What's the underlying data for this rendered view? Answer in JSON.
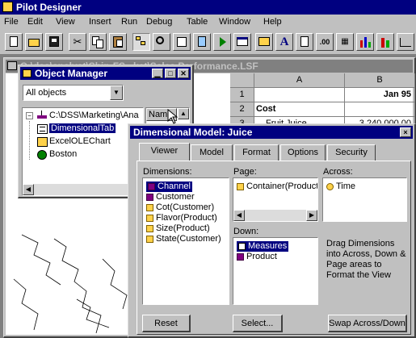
{
  "app": {
    "title": "Pilot Designer",
    "menu": [
      "File",
      "Edit",
      "View",
      "Insert",
      "Run",
      "Debug",
      "Table",
      "Window",
      "Help"
    ]
  },
  "document": {
    "title": "C:\\dss\\analyst\\Ship-FS...ket\\Sales Performance.LSF",
    "columns": [
      "A",
      "B"
    ],
    "rows": [
      "1",
      "2",
      "3"
    ],
    "b1": "Jan 95",
    "a2": "Cost",
    "a3_partial": "Fruit Juice",
    "b3_partial": "3,240,000.00"
  },
  "object_manager": {
    "title": "Object Manager",
    "filter_value": "All objects",
    "tree_root": "C:\\DSS\\Marketing\\Ana",
    "items": [
      "DimensionalTab",
      "ExcelOLEChart",
      "Boston"
    ],
    "name_header": "Name"
  },
  "dialog": {
    "title": "Dimensional Model: Juice",
    "close_glyph": "×",
    "tabs": [
      "Viewer",
      "Model",
      "Format",
      "Options",
      "Security"
    ],
    "dimensions_label": "Dimensions:",
    "page_label": "Page:",
    "across_label": "Across:",
    "down_label": "Down:",
    "dimensions": [
      "Channel",
      "Customer",
      "Cot(Customer)",
      "Flavor(Product)",
      "Size(Product)",
      "State(Customer)"
    ],
    "page_items": [
      "Container(Product"
    ],
    "across_items": [
      "Time"
    ],
    "down_items": [
      "Measures",
      "Product"
    ],
    "hint": "Drag Dimensions into Across, Down & Page areas to Format the View",
    "buttons": {
      "reset": "Reset",
      "select": "Select...",
      "swap": "Swap Across/Down"
    }
  }
}
